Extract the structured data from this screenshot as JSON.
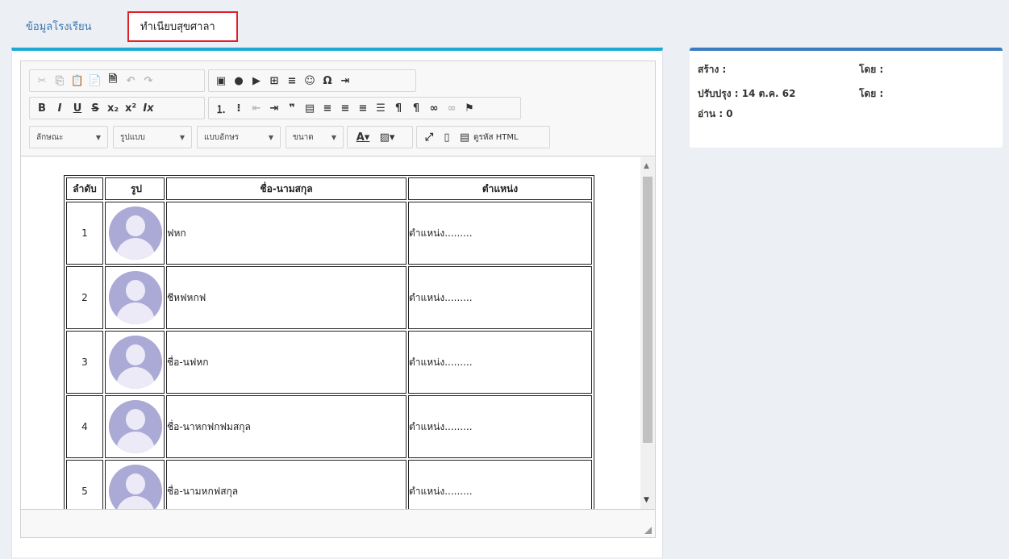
{
  "tabs": {
    "info": "ข้อมูลโรงเรียน",
    "registry": "ทำเนียบสุขศาลา"
  },
  "toolbar": {
    "combos": {
      "style": "ลักษณะ",
      "format": "รูปแบบ",
      "font": "แบบอักษร",
      "size": "ขนาด"
    },
    "source_label": "ดูรหัส HTML"
  },
  "table": {
    "headers": [
      "ลำดับ",
      "รูป",
      "ชื่อ-นามสกุล",
      "ตำแหน่ง"
    ],
    "rows": [
      {
        "no": "1",
        "name": "ฟหก",
        "position": "ตำแหน่ง........."
      },
      {
        "no": "2",
        "name": "ชีหฟหกฟ",
        "position": "ตำแหน่ง........."
      },
      {
        "no": "3",
        "name": "ชื่อ-นฟหก",
        "position": "ตำแหน่ง........."
      },
      {
        "no": "4",
        "name": "ชื่อ-นาหกฟกฟมสกุล",
        "position": "ตำแหน่ง........."
      },
      {
        "no": "5",
        "name": "ชื่อ-นามหกฟสกุล",
        "position": "ตำแหน่ง........."
      }
    ]
  },
  "meta": {
    "created": "สร้าง :",
    "created_by": "โดย :",
    "updated": "ปรับปรุง : 14 ต.ค. 62",
    "updated_by": "โดย :",
    "reads": "อ่าน : 0"
  }
}
